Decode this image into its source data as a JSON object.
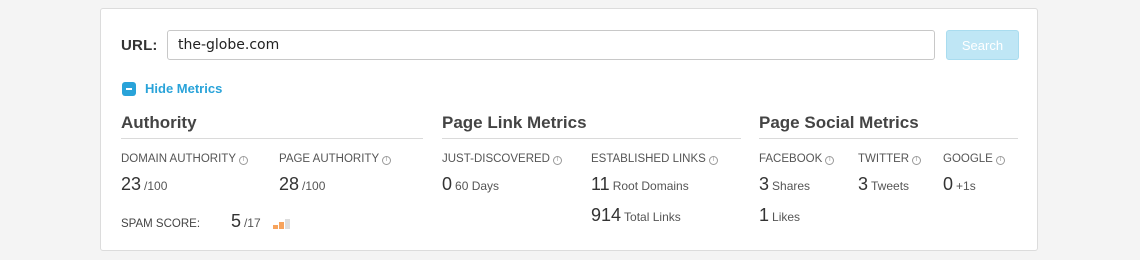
{
  "search": {
    "label": "URL:",
    "value": "the-globe.com",
    "button": "Search"
  },
  "toggle": {
    "label": "Hide Metrics"
  },
  "authority": {
    "title": "Authority",
    "domain_authority": {
      "label": "DOMAIN AUTHORITY",
      "value": "23",
      "unit": "/100"
    },
    "page_authority": {
      "label": "PAGE AUTHORITY",
      "value": "28",
      "unit": "/100"
    },
    "spam_score": {
      "label": "SPAM SCORE:",
      "value": "5",
      "unit": "/17",
      "bars_filled": 2,
      "bars_total": 3
    }
  },
  "page_links": {
    "title": "Page Link Metrics",
    "just_discovered": {
      "label": "JUST-DISCOVERED",
      "value": "0",
      "unit": "60 Days"
    },
    "established_links": {
      "label": "ESTABLISHED LINKS",
      "root_domains": {
        "value": "11",
        "unit": "Root Domains"
      },
      "total_links": {
        "value": "914",
        "unit": "Total Links"
      }
    }
  },
  "social": {
    "title": "Page Social Metrics",
    "facebook": {
      "label": "FACEBOOK",
      "shares": {
        "value": "3",
        "unit": "Shares"
      },
      "likes": {
        "value": "1",
        "unit": "Likes"
      }
    },
    "twitter": {
      "label": "TWITTER",
      "value": "3",
      "unit": "Tweets"
    },
    "google": {
      "label": "GOOGLE",
      "value": "0",
      "unit": "+1s"
    }
  },
  "icons": {
    "info": "info-icon",
    "toggle": "minus-icon"
  },
  "colors": {
    "accent": "#29a3d9",
    "search_button": "#bfe6f5",
    "spam_bar_on": "#f7a35c",
    "spam_bar_off": "#dddddd"
  }
}
